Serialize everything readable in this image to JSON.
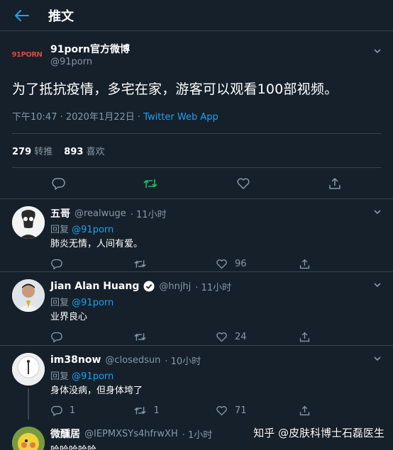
{
  "header": {
    "title": "推文"
  },
  "tweet": {
    "logo_text": "91PORN",
    "display_name": "91porn官方微博",
    "handle": "@91porn",
    "text": "为了抵抗疫情，多宅在家，游客可以观看100部视频。",
    "time_date": "下午10:47 · 2020年1月22日 ·",
    "source": "Twitter Web App",
    "retweets_count": "279",
    "retweets_label": "转推",
    "likes_count": "893",
    "likes_label": "喜欢"
  },
  "replies": [
    {
      "name": "五哥",
      "handle": "@realwuge",
      "time": "· 11小时",
      "replying_label": "回复",
      "replying_to": "@91porn",
      "text": "肺炎无情，人间有爱。",
      "reply_count": "",
      "retweet_count": "",
      "like_count": "96"
    },
    {
      "name": "Jian Alan Huang",
      "handle": "@hnjhj",
      "time": "· 11小时",
      "replying_label": "回复",
      "replying_to": "@91porn",
      "text": "业界良心",
      "reply_count": "",
      "retweet_count": "",
      "like_count": "24"
    },
    {
      "name": "im38now",
      "handle": "@closedsun",
      "time": "· 10小时",
      "replying_label": "回复",
      "replying_to": "@91porn",
      "text": "身体没病，但身体垮了",
      "reply_count": "1",
      "retweet_count": "1",
      "like_count": "71"
    },
    {
      "name": "微醺居",
      "handle": "@IEPMXSYs4hfrwXH",
      "time": "· 1小时",
      "text": "哈哈哈哈哈"
    }
  ],
  "watermark": "知乎 @皮肤科博士石磊医生",
  "colors": {
    "background": "#15202b",
    "accent": "#1da1f2",
    "muted": "#8899a6",
    "retweet_active": "#17bf63",
    "border": "#38444d"
  }
}
